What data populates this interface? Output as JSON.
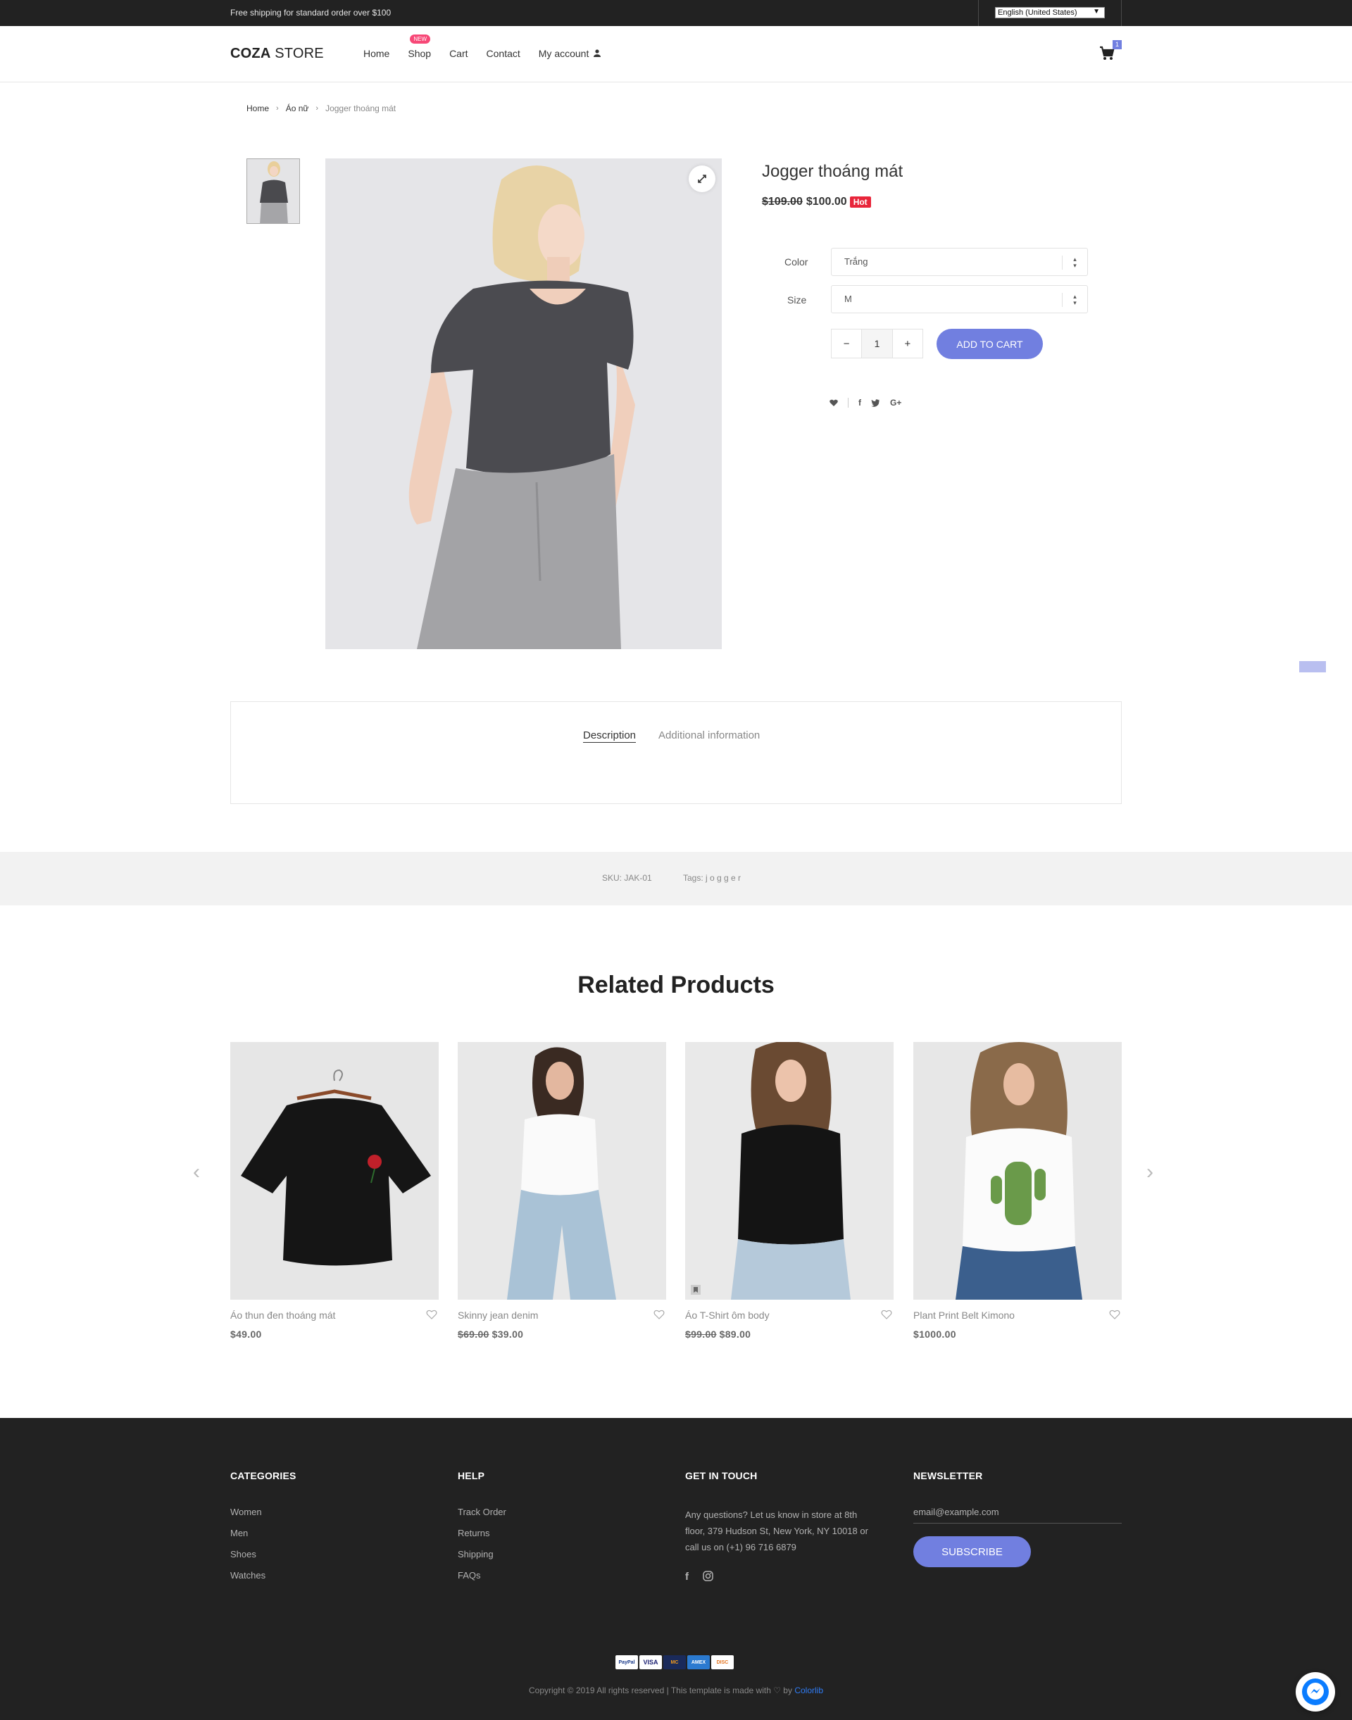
{
  "topbar": {
    "shipping_text": "Free shipping for standard order over $100",
    "language": "English (United States)"
  },
  "header": {
    "logo_bold": "COZA",
    "logo_rest": " STORE",
    "nav": [
      {
        "label": "Home"
      },
      {
        "label": "Shop",
        "badge": "NEW"
      },
      {
        "label": "Cart"
      },
      {
        "label": "Contact"
      },
      {
        "label": "My account"
      }
    ],
    "cart_count": "1"
  },
  "breadcrumb": [
    "Home",
    "Áo nữ",
    "Jogger thoáng mát"
  ],
  "product": {
    "title": "Jogger thoáng mát",
    "old_price": "$109.00",
    "price": "$100.00",
    "badge": "Hot",
    "color_label": "Color",
    "color_value": "Trắng",
    "size_label": "Size",
    "size_value": "M",
    "qty_minus": "−",
    "qty": "1",
    "qty_plus": "+",
    "add_to_cart": "ADD TO CART"
  },
  "tabs": {
    "description": "Description",
    "additional": "Additional information"
  },
  "meta": {
    "sku": "SKU: JAK-01",
    "tags": "Tags: j o g g e r"
  },
  "related": {
    "title": "Related Products",
    "prev": "‹",
    "next": "›",
    "items": [
      {
        "name": "Áo thun đen thoáng mát",
        "old_price": "",
        "price": "$49.00"
      },
      {
        "name": "Skinny jean denim",
        "old_price": "$69.00",
        "price": "$39.00"
      },
      {
        "name": "Áo T-Shirt ôm body",
        "old_price": "$99.00",
        "price": "$89.00"
      },
      {
        "name": "Plant Print Belt Kimono",
        "old_price": "",
        "price": "$1000.00"
      }
    ]
  },
  "footer": {
    "categories": {
      "title": "CATEGORIES",
      "items": [
        "Women",
        "Men",
        "Shoes",
        "Watches"
      ]
    },
    "help": {
      "title": "HELP",
      "items": [
        "Track Order",
        "Returns",
        "Shipping",
        "FAQs"
      ]
    },
    "contact": {
      "title": "GET IN TOUCH",
      "text": "Any questions? Let us know in store at 8th floor, 379 Hudson St, New York, NY 10018 or call us on (+1) 96 716 6879"
    },
    "newsletter": {
      "title": "NEWSLETTER",
      "placeholder": "email@example.com",
      "button": "SUBSCRIBE"
    },
    "payments": [
      "PayPal",
      "VISA",
      "MC",
      "AMEX",
      "DISC"
    ],
    "copyright_prefix": "Copyright © 2019 All rights reserved | This template is made with ♡ by ",
    "copyright_link": "Colorlib"
  },
  "colors": {
    "accent": "#717fe0",
    "hot": "#e8253a",
    "new_badge": "#f74877",
    "dark": "#222222"
  }
}
